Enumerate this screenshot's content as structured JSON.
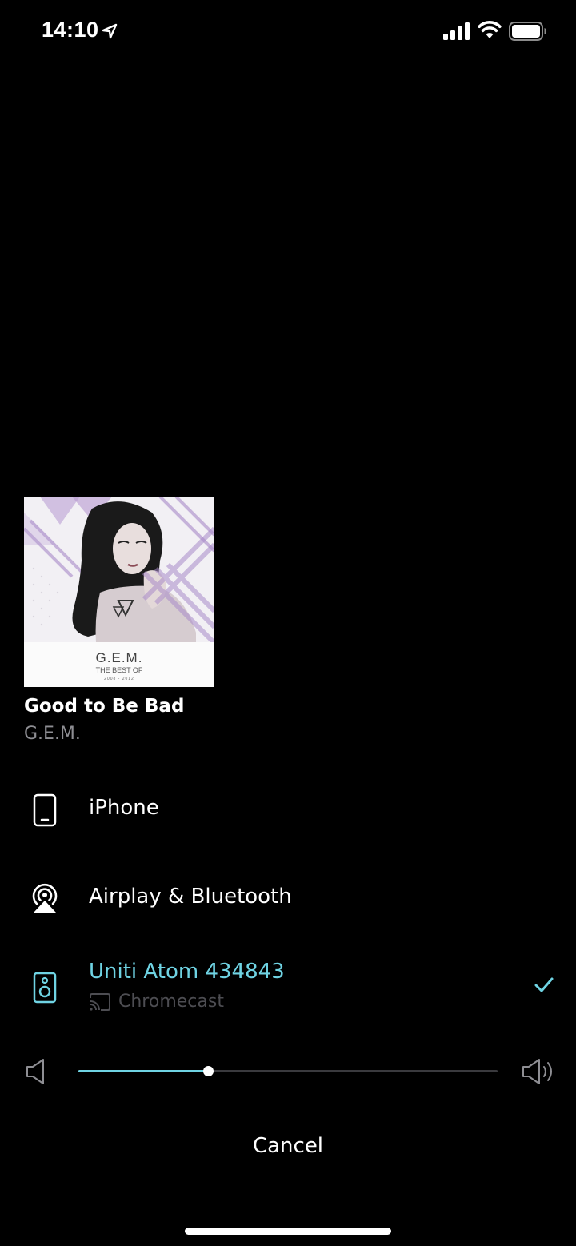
{
  "status_bar": {
    "time": "14:10",
    "icons": [
      "location-arrow-icon",
      "cellular-signal-icon",
      "wifi-icon",
      "battery-icon"
    ]
  },
  "now_playing": {
    "album_art": {
      "icon": "album-art-image",
      "art_text": {
        "artist": "G.E.M.",
        "subtitle": "THE BEST OF",
        "years": "2008 - 2012"
      }
    },
    "title": "Good to Be Bad",
    "artist": "G.E.M."
  },
  "devices": [
    {
      "label": "iPhone",
      "icon": "iphone-icon",
      "selected": false
    },
    {
      "label": "Airplay & Bluetooth",
      "icon": "airplay-icon",
      "selected": false
    },
    {
      "label": "Uniti Atom 434843",
      "sublabel": "Chromecast",
      "icon": "speaker-icon",
      "sub_icon": "cast-icon",
      "selected": true
    }
  ],
  "volume": {
    "level": 0.31,
    "icons": [
      "volume-low-icon",
      "volume-high-icon"
    ]
  },
  "cancel_label": "Cancel",
  "colors": {
    "background": "#000000",
    "accent": "#6fd3e3",
    "secondary_text": "#8e8e93",
    "muted_text": "#4d4d52",
    "track": "#3a3a3e"
  }
}
